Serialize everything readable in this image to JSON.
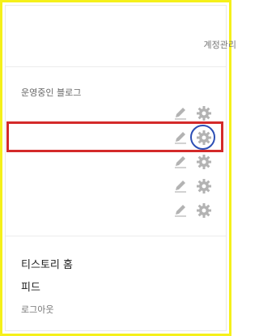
{
  "header": {
    "account_label": "계정관리"
  },
  "blogs": {
    "title": "운영중인 블로그",
    "rows": [
      {
        "edit_icon": "pencil-icon",
        "settings_icon": "gear-icon"
      },
      {
        "edit_icon": "pencil-icon",
        "settings_icon": "gear-icon"
      },
      {
        "edit_icon": "pencil-icon",
        "settings_icon": "gear-icon"
      },
      {
        "edit_icon": "pencil-icon",
        "settings_icon": "gear-icon"
      },
      {
        "edit_icon": "pencil-icon",
        "settings_icon": "gear-icon"
      }
    ]
  },
  "menu": {
    "home_label": "티스토리 홈",
    "feed_label": "피드",
    "logout_label": "로그아웃"
  },
  "colors": {
    "outer_border": "#f5f01a",
    "highlight_box": "#d42a2a",
    "highlight_circle": "#2d4fb5",
    "icon_gray": "#b3b3b3"
  }
}
